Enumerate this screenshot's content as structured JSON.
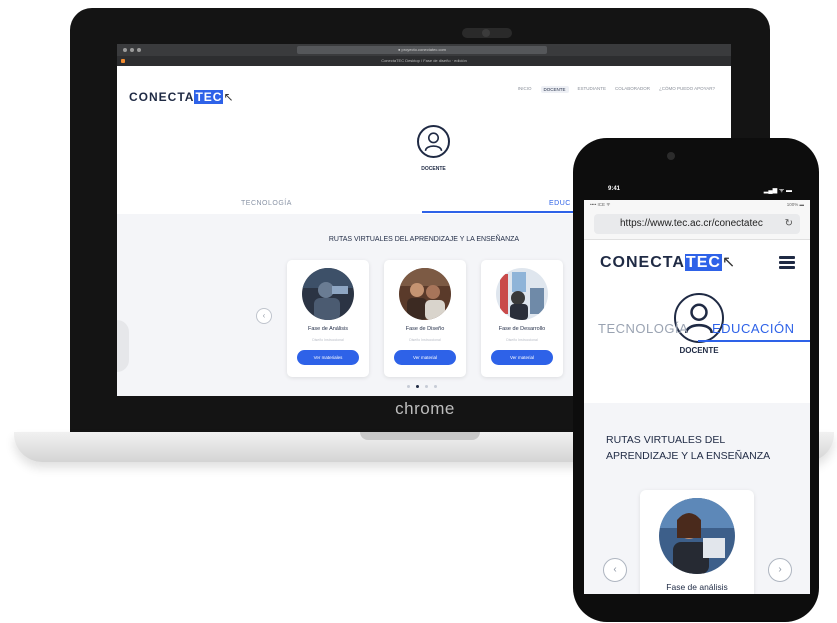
{
  "laptop": {
    "brand_label": "chrome",
    "browser": {
      "url": "● proyecto.conectatec.com",
      "tab_title": "ConectaTEC Desktop / Fase de diseño · edición"
    },
    "site": {
      "logo_main": "CONECTA",
      "logo_highlight": "TEC",
      "nav": [
        "INICIO",
        "DOCENTE",
        "ESTUDIANTE",
        "COLABORADOR",
        "¿CÓMO PUEDO APOYAR?"
      ],
      "role_label": "DOCENTE",
      "tab_left": "TECNOLOGÍA",
      "tab_right": "EDUC",
      "heading": "RUTAS VIRTUALES DEL APRENDIZAJE Y LA ENSEÑANZA",
      "cards": [
        {
          "title": "Fase de Análisis",
          "subtitle": "Diseño Instruccional",
          "button": "Ver materiales"
        },
        {
          "title": "Fase de Diseño",
          "subtitle": "Diseño Instruccional",
          "button": "Ver material"
        },
        {
          "title": "Fase de Desarrollo",
          "subtitle": "Diseño Instruccional",
          "button": "Ver material"
        }
      ],
      "prev_glyph": "‹"
    }
  },
  "phone": {
    "status": {
      "time": "9:41",
      "icons": "▂▄▆ ᯤ ▬"
    },
    "browser": {
      "carrier": "•••• ICE ᯤ",
      "battery": "100% ▬",
      "url": "https://www.tec.ac.cr/conectatec",
      "reload_glyph": "↻"
    },
    "site": {
      "logo_main": "CONECTA",
      "logo_highlight": "TEC",
      "role_label": "DOCENTE",
      "tab_left": "TECNOLOGÍA",
      "tab_right": "EDUCACIÓN",
      "heading_line1": "RUTAS VIRTUALES DEL",
      "heading_line2": "APRENDIZAJE Y LA ENSEÑANZA",
      "card_title": "Fase de análisis",
      "prev_glyph": "‹",
      "next_glyph": "›"
    }
  },
  "colors": {
    "accent": "#2e62e8",
    "navy": "#1f2a44",
    "frame": "#141414"
  }
}
